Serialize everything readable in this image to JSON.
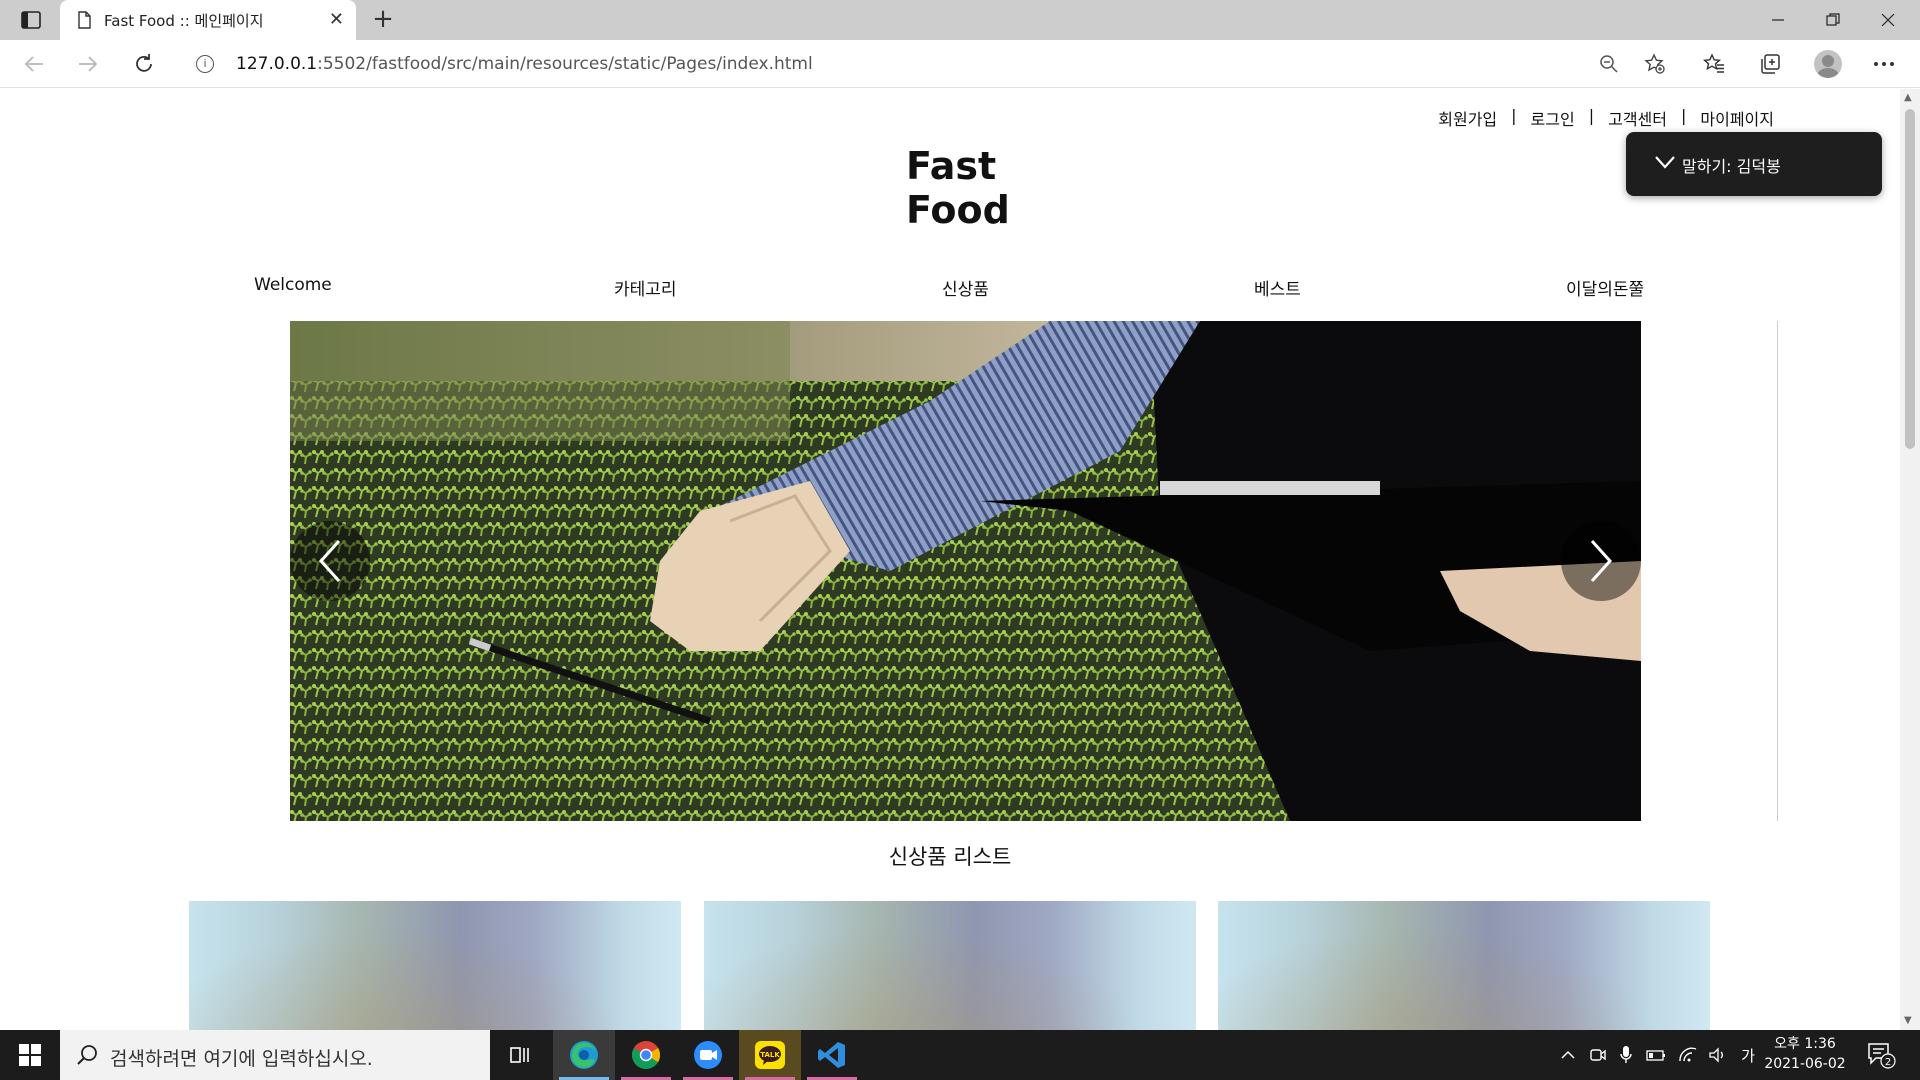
{
  "browser": {
    "tab_title": "Fast Food :: 메인페이지",
    "url_host": "127.0.0.1",
    "url_path": ":5502/fastfood/src/main/resources/static/Pages/index.html",
    "icons": {
      "tab_actions": "tab-actions-icon",
      "back": "back-arrow-icon",
      "forward": "forward-arrow-icon",
      "refresh": "refresh-icon",
      "zoom": "zoom-out-icon",
      "favorite_add": "add-favorite-icon",
      "favorites": "favorites-icon",
      "collections": "collections-icon",
      "more": "more-icon"
    }
  },
  "site": {
    "top_links": [
      "회원가입",
      "로그인",
      "고객센터",
      "마이페이지"
    ],
    "logo_line1": "Fast",
    "logo_line2": "Food",
    "nav": [
      "Welcome",
      "카테고리",
      "신상품",
      "베스트",
      "이달의돈쭐"
    ],
    "section_title": "신상품 리스트",
    "products_visible": 3
  },
  "speech_popup": {
    "text": "말하기: 김덕봉"
  },
  "taskbar": {
    "search_placeholder": "검색하려면 여기에 입력하십시오.",
    "apps": [
      "task-view",
      "edge",
      "chrome",
      "zoom",
      "kakaotalk",
      "vscode"
    ],
    "kakao_label": "TALK",
    "ime_label": "가",
    "clock_time": "오후 1:36",
    "clock_date": "2021-06-02",
    "notification_count": "2"
  },
  "colors": {
    "tabbar": "#cdcdcd",
    "taskbar": "#1c1c1c",
    "edge_underline": "#76b9ed",
    "open_underline": "#d86aa4",
    "kakao": "#fae100",
    "vscode": "#2f8fdc"
  }
}
